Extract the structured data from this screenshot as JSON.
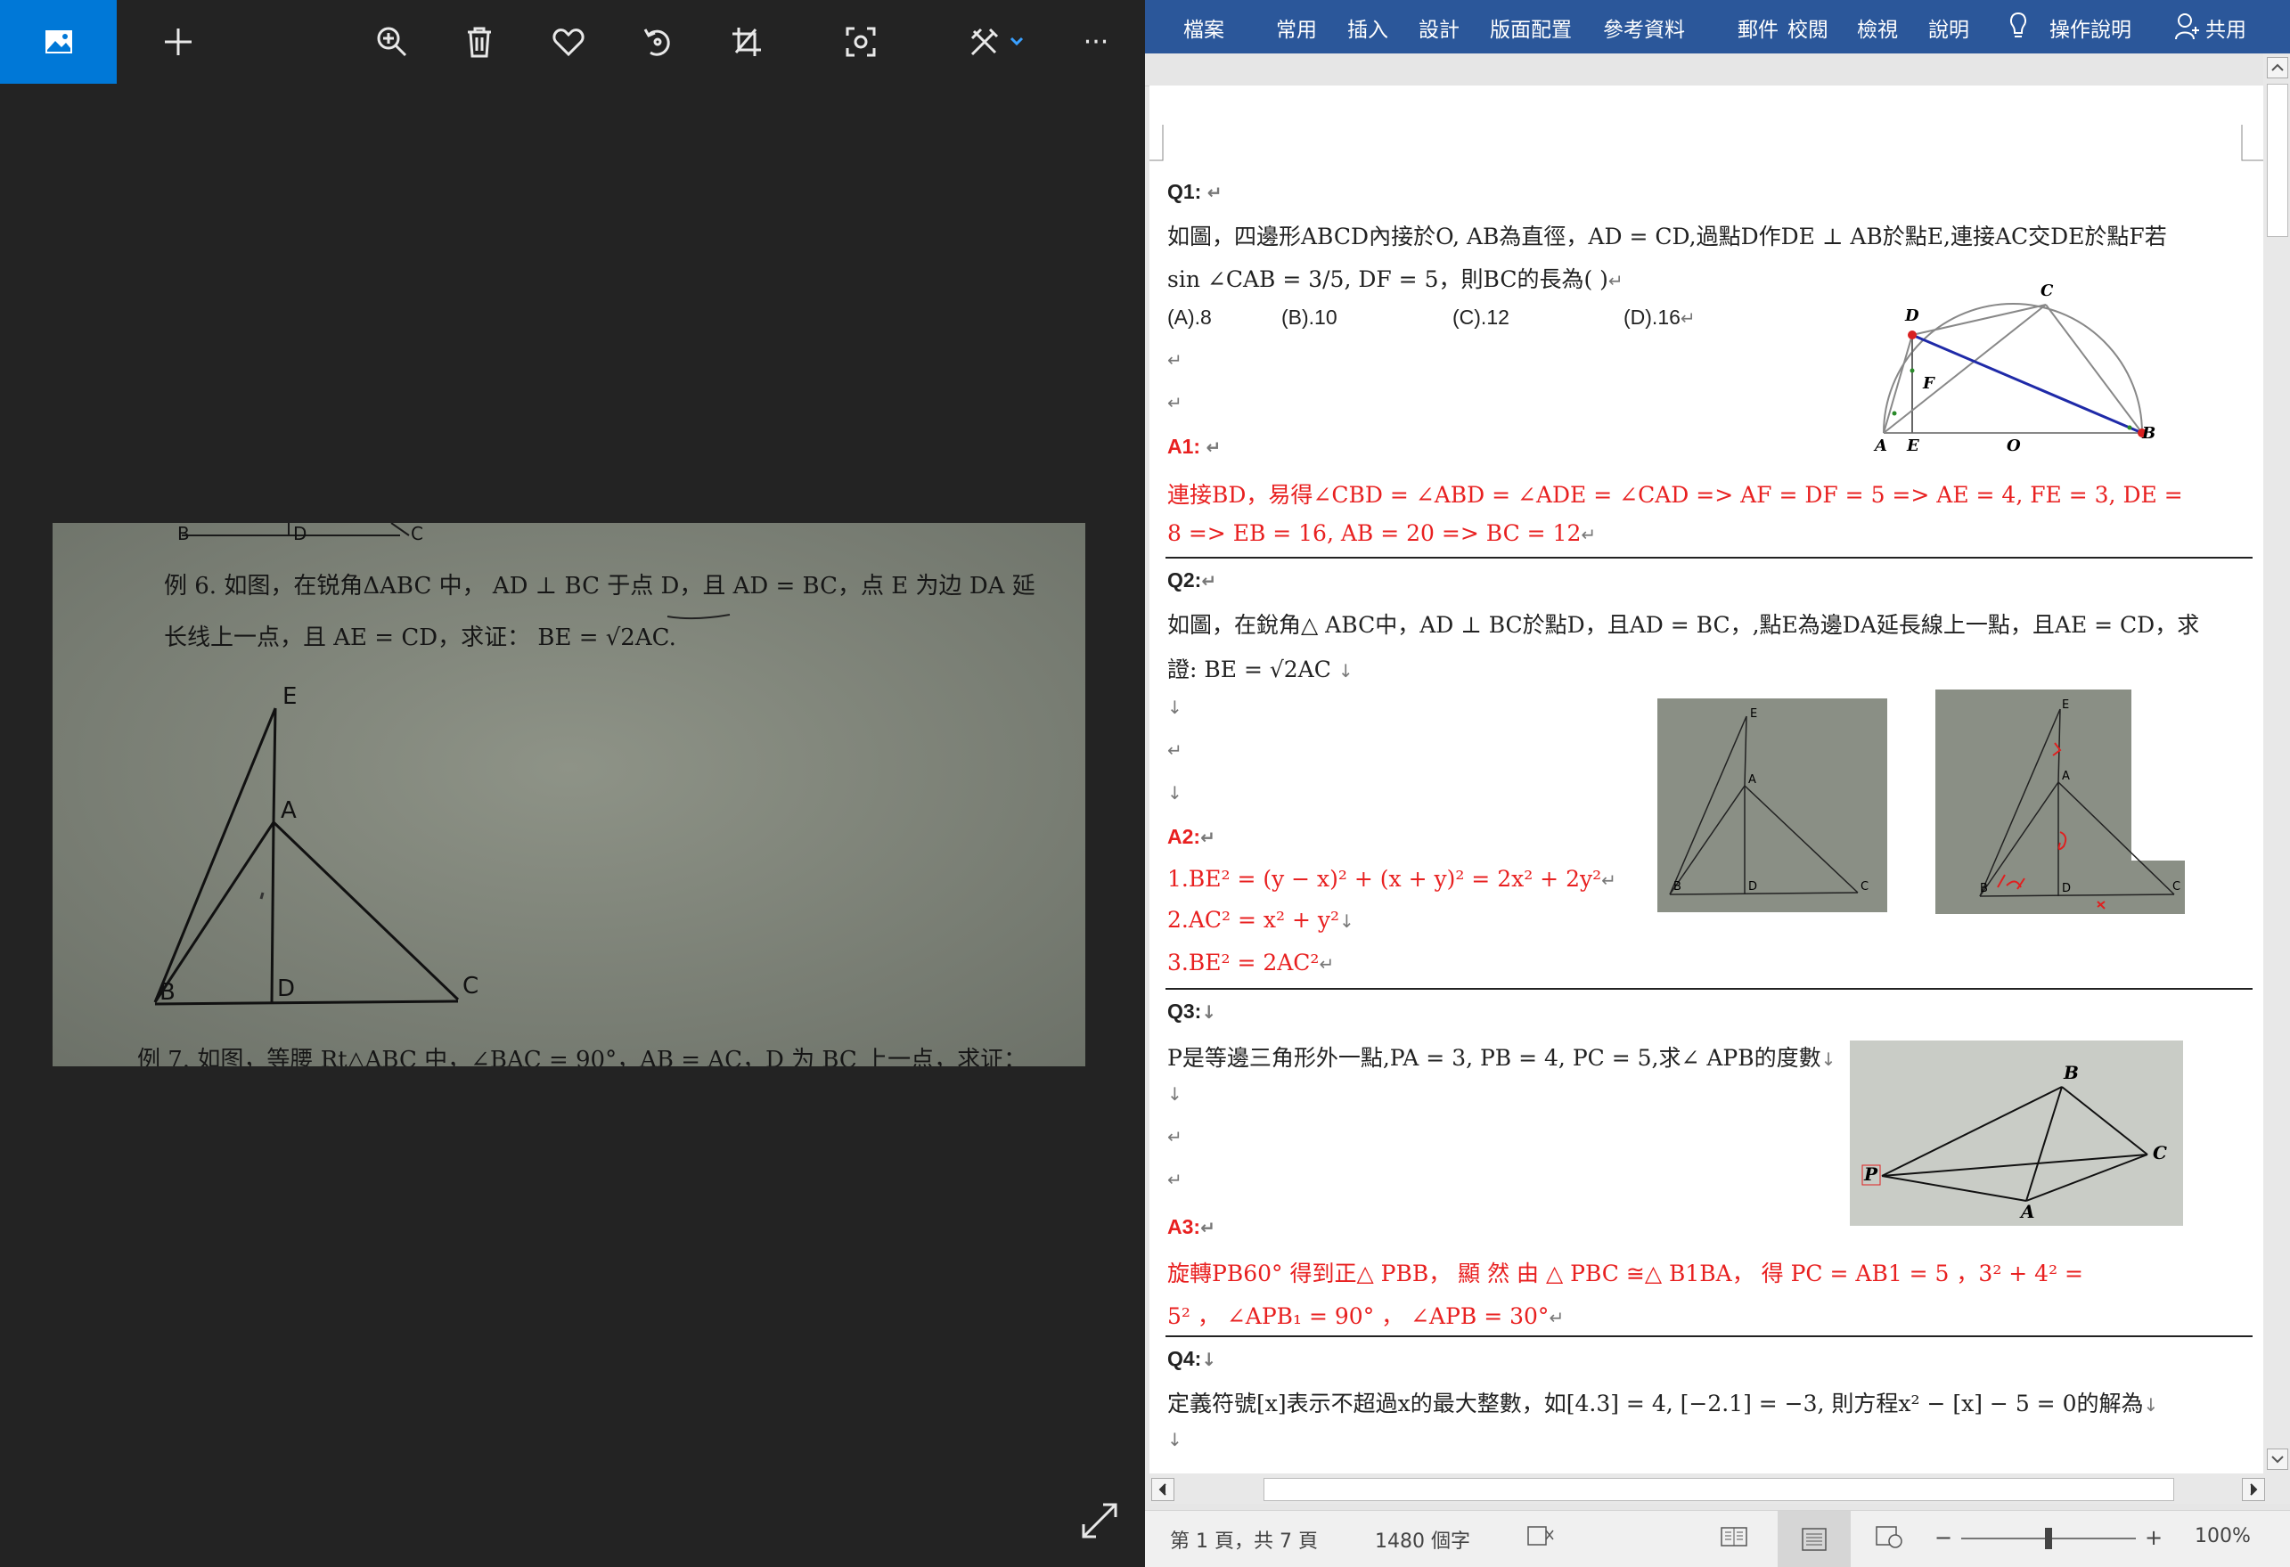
{
  "photos": {
    "toolbar": {
      "viewer_icon": "image-icon",
      "add_icon": "plus-icon",
      "zoom_icon": "zoom-in-icon",
      "delete_icon": "trash-icon",
      "favorite_icon": "heart-icon",
      "rotate_icon": "rotate-icon",
      "crop_icon": "crop-icon",
      "lens_icon": "focus-icon",
      "edit_icon": "edit-create-icon",
      "more_label": "···"
    },
    "photo": {
      "top_fragment_b": "B",
      "top_fragment_d": "D",
      "top_fragment_c": "C",
      "problem_line1": "例 6. 如图，在锐角ΔABC 中， AD ⊥ BC 于点 D，且 AD = BC，点 E 为边 DA 延",
      "problem_line2": "长线上一点，且 AE = CD，求证： BE = √2AC.",
      "labels": {
        "E": "E",
        "A": "A",
        "B": "B",
        "D": "D",
        "C": "C"
      },
      "bottom_fragment": "例 7. 如图，等腰 Rt△ABC 中，∠BAC = 90°，AB = AC，D 为 BC 上一点，求证："
    }
  },
  "word": {
    "ribbon_tabs": [
      "檔案",
      "常用",
      "插入",
      "設計",
      "版面配置",
      "參考資料",
      "郵件",
      "校閱",
      "檢視",
      "說明",
      "操作說明",
      "共用"
    ],
    "lines": {
      "q1_header": "Q1:",
      "q1_text": "如圖，四邊形ABCD內接於O, AB為直徑，AD = CD,過點D作DE ⊥ AB於點E,連接AC交DE於點F若",
      "q1_text2": "sin ∠CAB = 3/5, DF = 5，則BC的長為(    )",
      "q1_opt_a": "(A).8",
      "q1_opt_b": "(B).10",
      "q1_opt_c": "(C).12",
      "q1_opt_d": "(D).16",
      "a1_header": "A1:",
      "a1_line1": "連接BD，易得∠CBD = ∠ABD = ∠ADE = ∠CAD  =>  AF = DF = 5  =>  AE = 4, FE = 3, DE =",
      "a1_line2": "8  =>  EB = 16, AB = 20  =>  BC = 12",
      "q2_header": "Q2:",
      "q2_text": "如圖，在銳角△ ABC中，AD ⊥ BC於點D，且AD = BC，,點E為邊DA延長線上一點，且AE = CD，求",
      "q2_text2": "證: BE = √2AC",
      "a2_header": "A2:",
      "a2_line1": "1.BE² = (y − x)² + (x + y)² = 2x² + 2y²",
      "a2_line2": "2.AC² = x² + y²",
      "a2_line3": "3.BE² = 2AC²",
      "q3_header": "Q3:",
      "q3_text": "P是等邊三角形外一點,PA = 3, PB = 4, PC = 5,求∠ APB的度數",
      "a3_header": "A3:",
      "a3_line1": "旋轉PB60° 得到正△ PBB， 顯 然 由 △ PBC ≅△ B1BA， 得 PC = AB1 = 5 ，3² + 4² =",
      "a3_line2": "5² ， ∠APB₁ = 90° ， ∠APB = 30°",
      "q4_header": "Q4:",
      "q4_text": "定義符號[x]表示不超過x的最大整數，如[4.3] = 4, [−2.1] = −3, 則方程x² − [x] − 5 = 0的解為"
    },
    "fig_labels": {
      "q1": [
        "D",
        "C",
        "F",
        "A",
        "E",
        "O",
        "B"
      ],
      "q2": [
        "E",
        "A",
        "B",
        "D",
        "C"
      ],
      "q3": [
        "B",
        "P",
        "C",
        "A"
      ]
    },
    "status": {
      "page": "第 1 頁，共 7 頁",
      "words": "1480 個字",
      "zoom": "100%",
      "zoom_minus": "−",
      "zoom_plus": "+"
    }
  }
}
